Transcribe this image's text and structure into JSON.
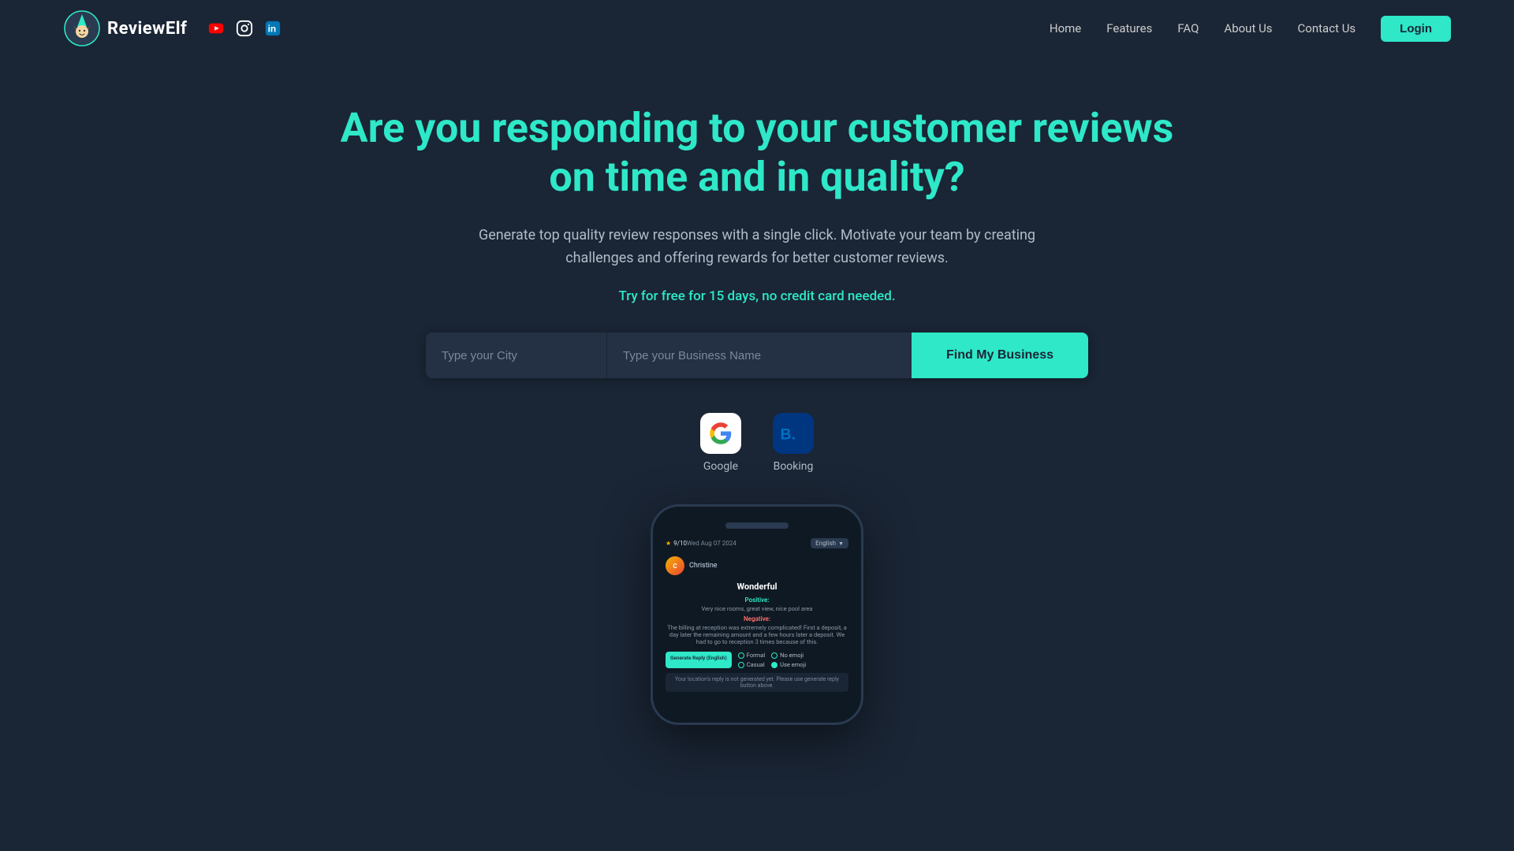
{
  "brand": {
    "name": "ReviewElf",
    "logoAlt": "ReviewElf logo"
  },
  "social": {
    "youtube": "▶",
    "instagram": "📷",
    "linkedin": "in"
  },
  "navbar": {
    "links": [
      {
        "label": "Home",
        "id": "home"
      },
      {
        "label": "Features",
        "id": "features"
      },
      {
        "label": "FAQ",
        "id": "faq"
      },
      {
        "label": "About Us",
        "id": "about"
      },
      {
        "label": "Contact Us",
        "id": "contact"
      }
    ],
    "loginLabel": "Login"
  },
  "hero": {
    "title": "Are you responding to your customer reviews on time and in quality?",
    "subtitle": "Generate top quality review responses with a single click. Motivate your team by creating challenges and offering rewards for better customer reviews.",
    "ctaText": "Try for free for 15 days, no credit card needed."
  },
  "search": {
    "cityPlaceholder": "Type your City",
    "businessPlaceholder": "Type your Business Name",
    "buttonLabel": "Find My Business"
  },
  "platforms": [
    {
      "label": "Google",
      "symbol": "G"
    },
    {
      "label": "Booking",
      "symbol": "B."
    }
  ],
  "phone": {
    "stars": "9/10",
    "date": "Wed Aug 07 2024",
    "reviewer": "Christine",
    "language": "English",
    "title": "Wonderful",
    "positiveLabel": "Positive:",
    "positiveText": "Very nice rooms, great view, nice pool area",
    "negativeLabel": "Negative:",
    "negativeText": "The billing at reception was extremely complicated! First a deposit, a day later the remaining amount and a few hours later a deposit. We had to go to reception 3 times because of this.",
    "buttonLabel": "Generate Reply (English)",
    "options": [
      {
        "label": "Formal",
        "selected": false
      },
      {
        "label": "No emoji",
        "selected": false
      },
      {
        "label": "Casual",
        "selected": false
      },
      {
        "label": "Use emoji",
        "selected": true
      }
    ],
    "notice": "Your location's reply is not generated yet. Please use generate reply button above."
  }
}
